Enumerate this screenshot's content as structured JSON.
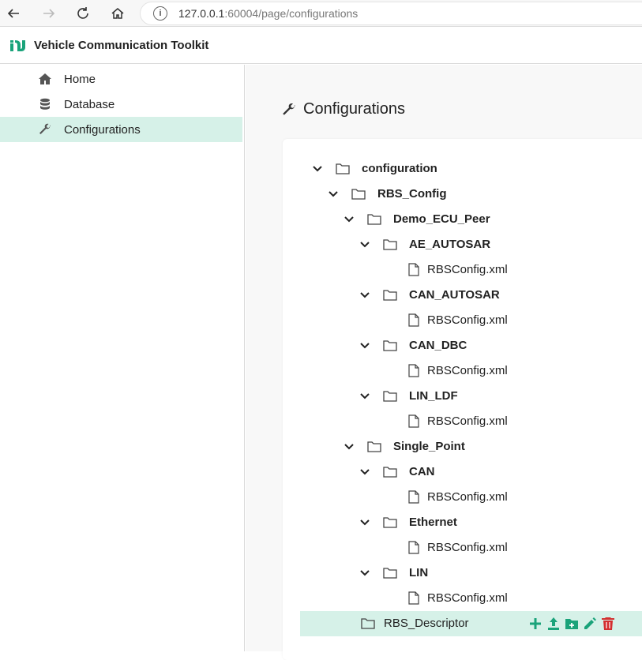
{
  "browser": {
    "url_host": "127.0.0.1",
    "url_rest": ":60004/page/configurations"
  },
  "app": {
    "title": "Vehicle Communication Toolkit"
  },
  "sidebar": {
    "items": [
      {
        "label": "Home",
        "icon": "home-icon"
      },
      {
        "label": "Database",
        "icon": "database-icon"
      },
      {
        "label": "Configurations",
        "icon": "wrench-icon",
        "active": true
      }
    ]
  },
  "main": {
    "title": "Configurations"
  },
  "tree": {
    "root": "configuration",
    "rbs_config": "RBS_Config",
    "demo_ecu_peer": "Demo_ECU_Peer",
    "ae_autosar": "AE_AUTOSAR",
    "can_autosar": "CAN_AUTOSAR",
    "can_dbc": "CAN_DBC",
    "lin_ldf": "LIN_LDF",
    "single_point": "Single_Point",
    "can": "CAN",
    "ethernet": "Ethernet",
    "lin": "LIN",
    "file": "RBSConfig.xml",
    "rbs_descriptor": "RBS_Descriptor"
  },
  "colors": {
    "accent": "#1aa37a",
    "selected_bg": "#d6f1e8",
    "danger": "#d32f2f"
  }
}
